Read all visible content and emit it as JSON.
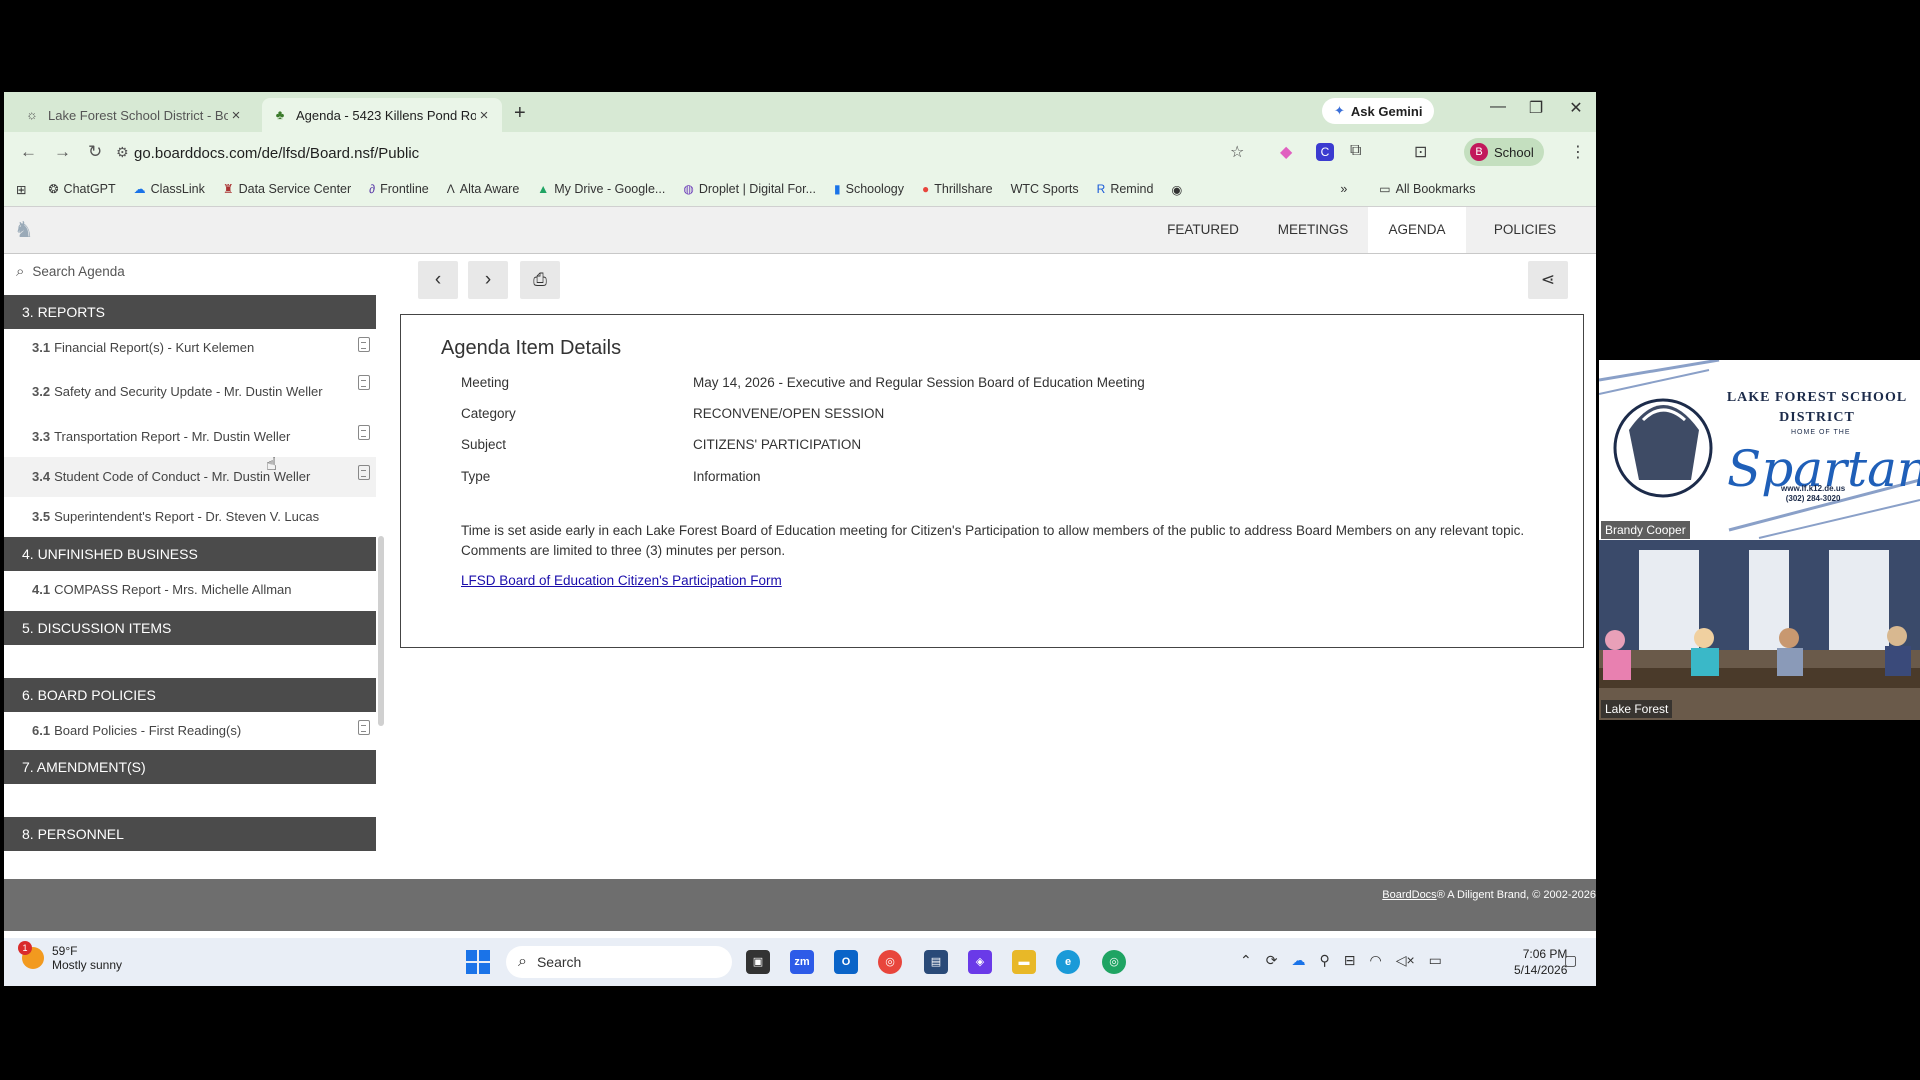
{
  "browser": {
    "tabs": [
      {
        "title": "Lake Forest School District - Bo",
        "active": false
      },
      {
        "title": "Agenda - 5423 Killens Pond Ro",
        "active": true
      }
    ],
    "ask_gemini": "Ask Gemini",
    "url": "go.boarddocs.com/de/lfsd/Board.nsf/Public",
    "profile_label": "School",
    "profile_initial": "B",
    "bookmarks": [
      "ChatGPT",
      "ClassLink",
      "Data Service Center",
      "Frontline",
      "Alta Aware",
      "My Drive - Google...",
      "Droplet | Digital For...",
      "Schoology",
      "Thrillshare",
      "WTC Sports",
      "Remind"
    ],
    "all_bookmarks": "All Bookmarks"
  },
  "nav": {
    "featured": "FEATURED",
    "meetings": "MEETINGS",
    "agenda": "AGENDA",
    "policies": "POLICIES"
  },
  "search": {
    "placeholder": "Search Agenda"
  },
  "sidebar": {
    "sections": [
      {
        "label": "3. REPORTS"
      },
      {
        "label": "4. UNFINISHED BUSINESS"
      },
      {
        "label": "5. DISCUSSION ITEMS"
      },
      {
        "label": "6. BOARD POLICIES"
      },
      {
        "label": "7. AMENDMENT(S)"
      },
      {
        "label": "8. PERSONNEL"
      }
    ],
    "items": [
      {
        "num": "3.1",
        "label": "Financial Report(s) - Kurt Kelemen"
      },
      {
        "num": "3.2",
        "label": "Safety and Security Update - Mr. Dustin Weller"
      },
      {
        "num": "3.3",
        "label": "Transportation Report - Mr. Dustin Weller"
      },
      {
        "num": "3.4",
        "label": "Student Code of Conduct - Mr. Dustin Weller"
      },
      {
        "num": "3.5",
        "label": "Superintendent's Report - Dr. Steven V. Lucas"
      },
      {
        "num": "4.1",
        "label": "COMPASS Report - Mrs. Michelle Allman"
      },
      {
        "num": "6.1",
        "label": "Board Policies - First Reading(s)"
      }
    ]
  },
  "details": {
    "title": "Agenda Item Details",
    "meeting_label": "Meeting",
    "meeting_value": "May 14, 2026 - Executive and Regular Session Board of Education Meeting",
    "category_label": "Category",
    "category_value": "RECONVENE/OPEN SESSION",
    "subject_label": "Subject",
    "subject_value": "CITIZENS' PARTICIPATION",
    "type_label": "Type",
    "type_value": "Information",
    "description": "Time is set aside early in each Lake Forest Board of Education meeting for Citizen's Participation to allow members of the public to address Board Members on any relevant topic. Comments are limited to three (3) minutes per person.",
    "link": "LFSD Board of Education Citizen's Participation Form"
  },
  "footer": {
    "brand": "BoardDocs",
    "text": "® A Diligent Brand, © 2002-2026"
  },
  "taskbar": {
    "temp": "59°F",
    "weather": "Mostly sunny",
    "weather_badge": "1",
    "search": "Search",
    "time": "7:06 PM",
    "date": "5/14/2026"
  },
  "video": {
    "district": "LAKE FOREST SCHOOL DISTRICT",
    "home_of": "HOME OF THE",
    "mascot": "Spartans",
    "web": "www.lf.k12.de.us",
    "phone": "(302) 284-3020",
    "speaker": "Brandy Cooper",
    "room": "Lake Forest"
  }
}
